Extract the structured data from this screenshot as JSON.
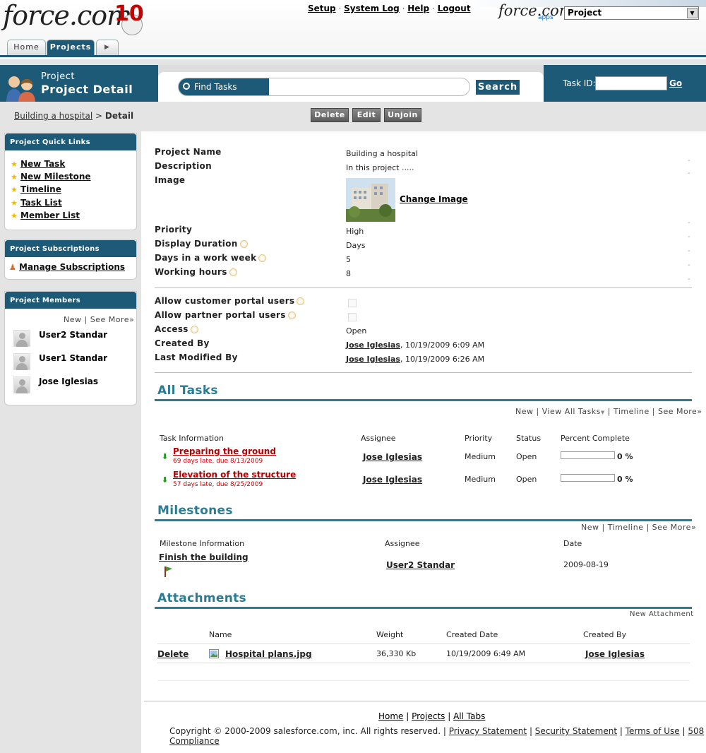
{
  "header": {
    "logo_text": "force.com",
    "logo_suffix": "10",
    "top_links": [
      "Setup",
      "System Log",
      "Help",
      "Logout"
    ],
    "apps_logo": "force.com",
    "apps_sub": "apps",
    "app_select": "Project",
    "tabs": {
      "home": "Home",
      "projects": "Projects"
    }
  },
  "band": {
    "subtitle": "Project",
    "title": "Project Detail",
    "find_label": "Find Tasks",
    "find_value": "",
    "search_button": "Search",
    "taskid_label": "Task ID:",
    "taskid_value": "",
    "go": "Go"
  },
  "breadcrumb": {
    "link": "Building a hospital",
    "sep": " > ",
    "current": "Detail"
  },
  "toolbar": {
    "delete": "Delete",
    "edit": "Edit",
    "unjoin": "Unjoin"
  },
  "sidebar": {
    "quick_links_title": "Project Quick Links",
    "quick_links": [
      "New Task",
      "New Milestone",
      "Timeline",
      "Task List",
      "Member List"
    ],
    "subscriptions_title": "Project Subscriptions",
    "manage_subscriptions": "Manage Subscriptions",
    "members_title": "Project Members",
    "members_new": "New",
    "members_see_more": "See More»",
    "members": [
      "User2 Standar",
      "User1 Standar",
      "Jose Iglesias"
    ]
  },
  "detail": {
    "labels": {
      "project_name": "Project Name",
      "description": "Description",
      "image": "Image",
      "priority": "Priority",
      "display_duration": "Display Duration",
      "days_week": "Days in a work week",
      "working_hours": "Working hours",
      "customer_portal": "Allow customer portal users",
      "partner_portal": "Allow partner portal users",
      "access": "Access",
      "created_by": "Created By",
      "modified_by": "Last Modified By"
    },
    "values": {
      "project_name": "Building a hospital",
      "description": "In this project .....",
      "change_image": "Change Image",
      "priority": "High",
      "display_duration": "Days",
      "days_week": "5",
      "working_hours": "8",
      "access": "Open",
      "created_by_user": "Jose Iglesias",
      "created_by_date": ", 10/19/2009 6:09 AM",
      "modified_by_user": "Jose Iglesias",
      "modified_by_date": ", 10/19/2009 6:26 AM"
    }
  },
  "tasks": {
    "title": "All Tasks",
    "links": "New | View All Tasks",
    "links2": " | Timeline | See More»",
    "headers": [
      "Task Information",
      "Assignee",
      "Priority",
      "Status",
      "Percent Complete"
    ],
    "rows": [
      {
        "name": "Preparing the ground",
        "note": "69 days late, due 8/13/2009",
        "assignee": "Jose Iglesias",
        "priority": "Medium",
        "status": "Open",
        "percent": "0 %",
        "percent_value": 0
      },
      {
        "name": "Elevation of the structure",
        "note": "57 days late, due 8/25/2009",
        "assignee": "Jose Iglesias",
        "priority": "Medium",
        "status": "Open",
        "percent": "0 %",
        "percent_value": 0
      }
    ]
  },
  "milestones": {
    "title": "Milestones",
    "links": "New | Timeline | See More»",
    "headers": [
      "Milestone Information",
      "Assignee",
      "Date"
    ],
    "rows": [
      {
        "name": "Finish the building",
        "assignee": "User2 Standar",
        "date": "2009-08-19"
      }
    ]
  },
  "attachments": {
    "title": "Attachments",
    "new": "New Attachment",
    "headers": [
      "Name",
      "Weight",
      "Created Date",
      "Created By"
    ],
    "rows": [
      {
        "action": "Delete",
        "name": "Hospital plans.jpg",
        "weight": "36,330 Kb",
        "date": "10/19/2009 6:49 AM",
        "created_by": "Jose Iglesias"
      }
    ]
  },
  "footer": {
    "links": [
      "Home",
      "Projects",
      "All Tabs"
    ],
    "copyright": "Copyright © 2000-2009 salesforce.com, inc. All rights reserved. |",
    "legal": [
      "Privacy Statement",
      "Security Statement",
      "Terms of Use",
      "508 Compliance"
    ]
  },
  "colors": {
    "brand_blue": "#1d5a77",
    "section_teal": "#2a7b94",
    "late_red": "#b30000"
  }
}
